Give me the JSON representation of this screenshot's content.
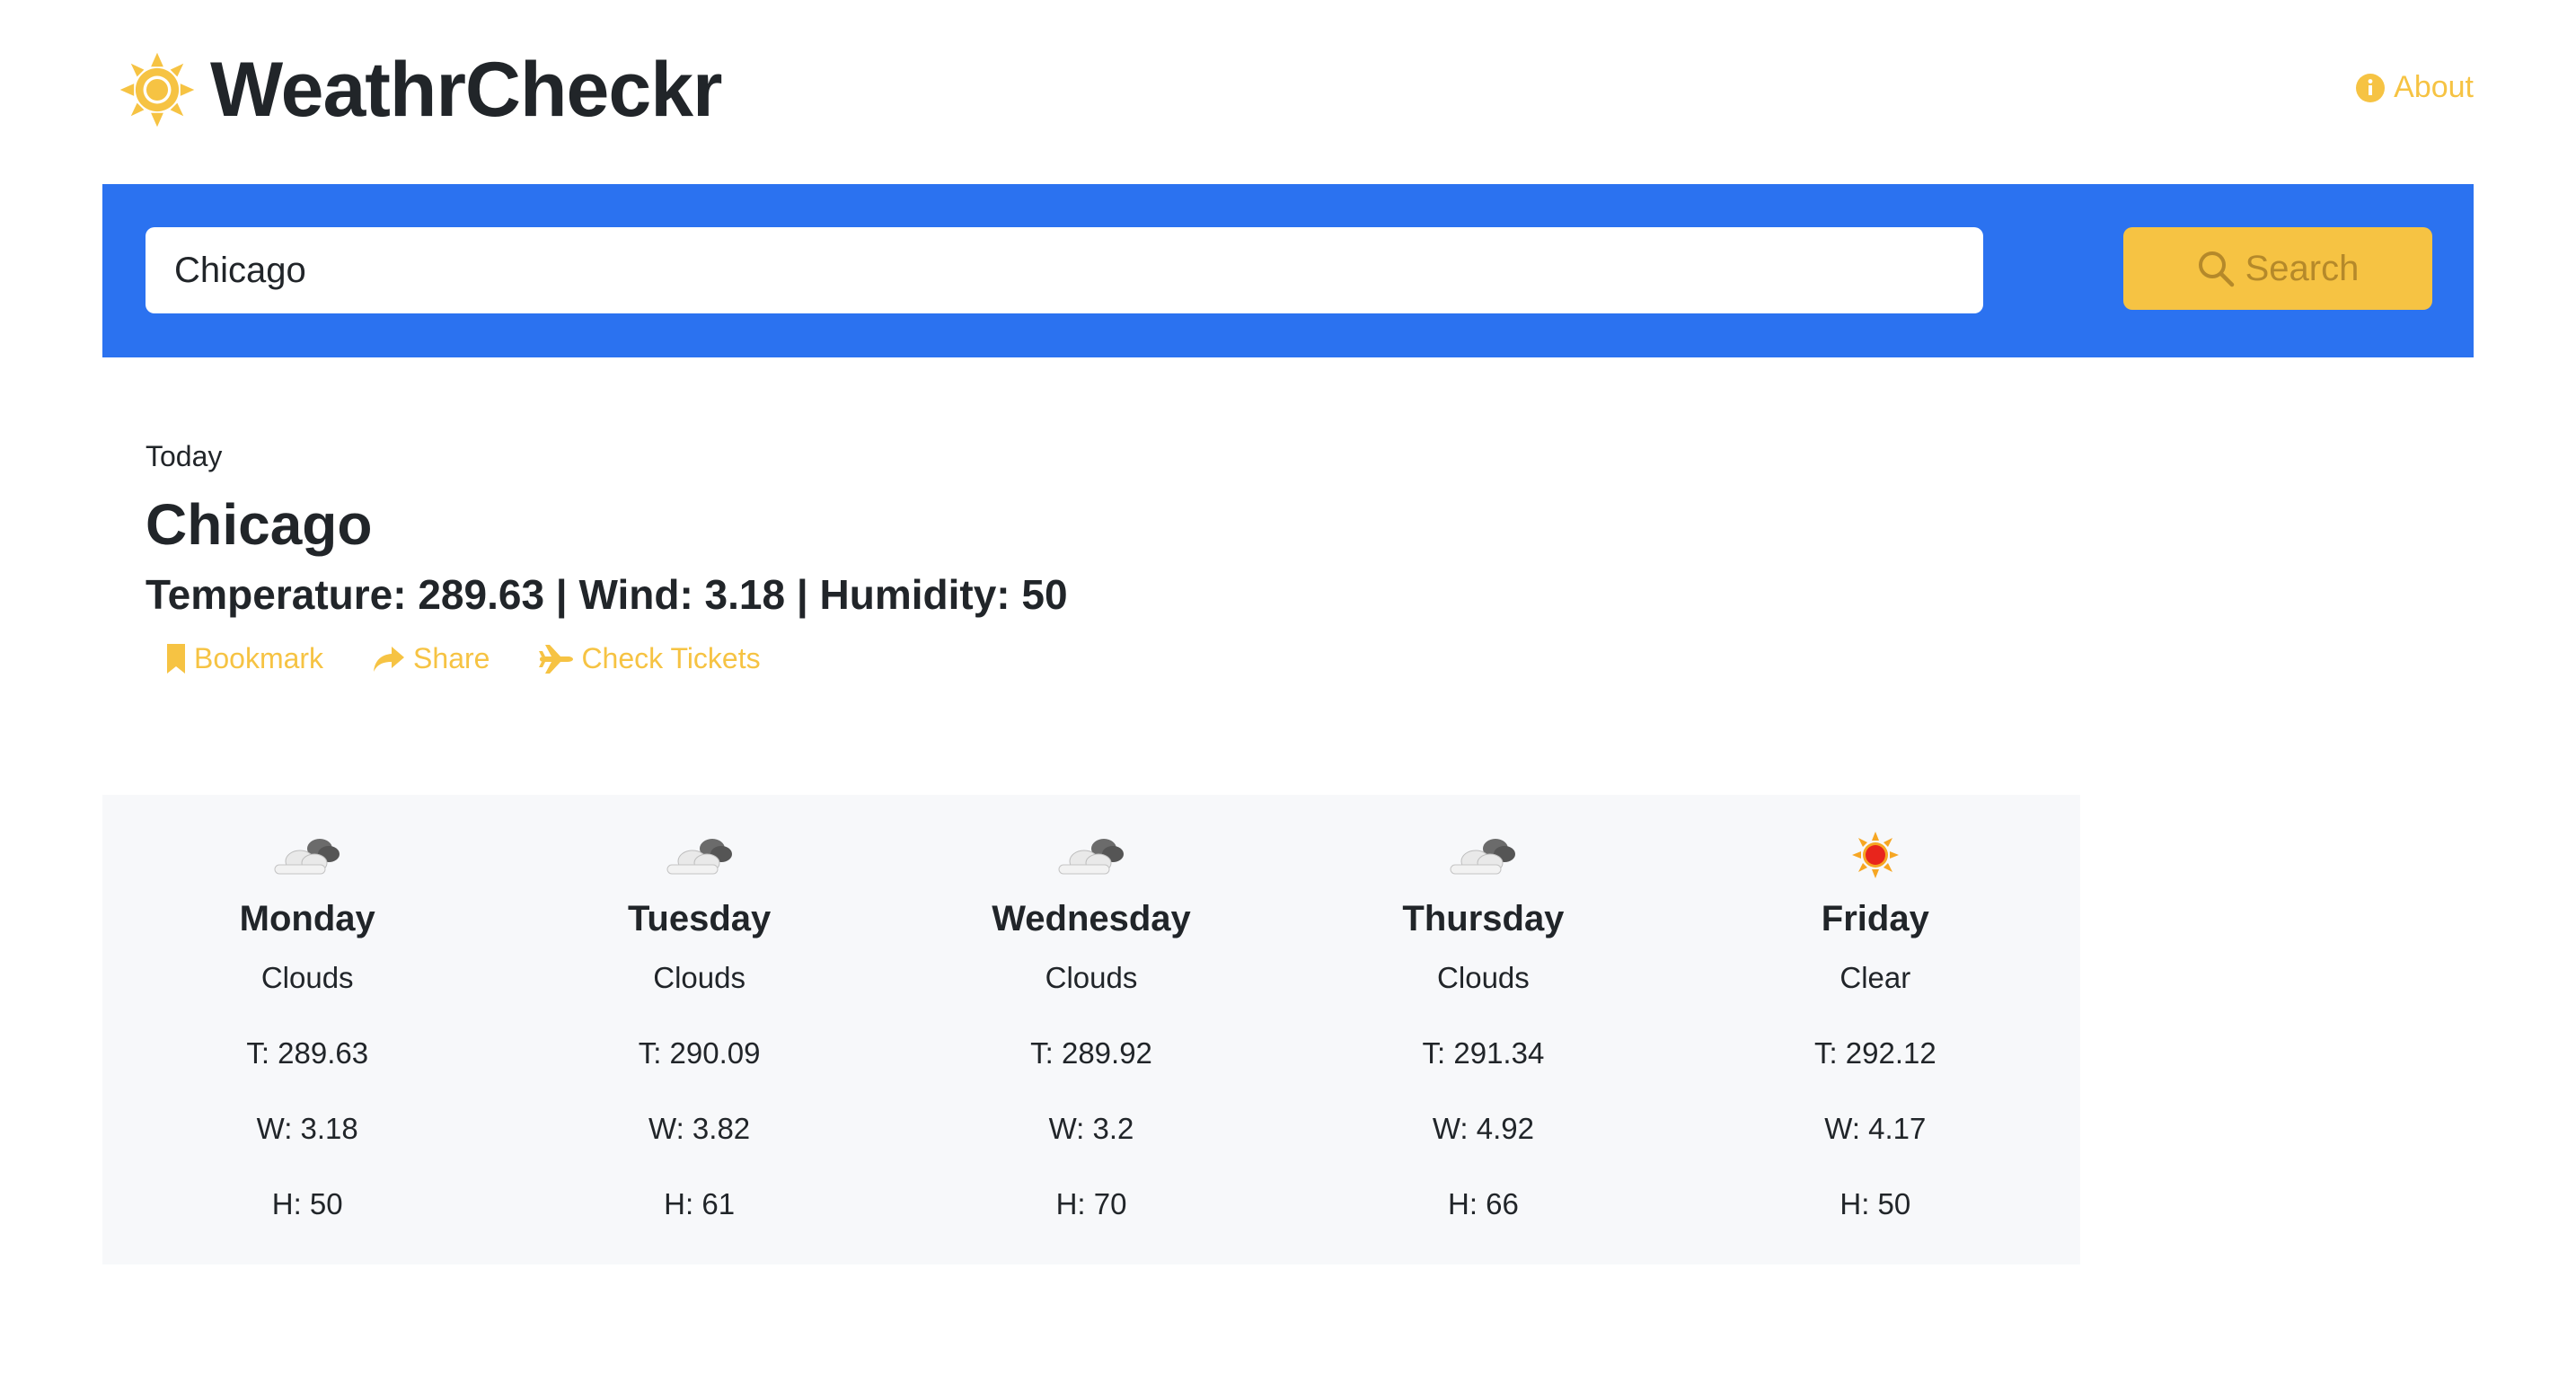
{
  "header": {
    "brand": "WeathrCheckr",
    "about_label": "About"
  },
  "search": {
    "value": "Chicago",
    "button_label": "Search"
  },
  "today": {
    "label": "Today",
    "city": "Chicago",
    "stats": "Temperature: 289.63 | Wind: 3.18 | Humidity: 50",
    "actions": {
      "bookmark": "Bookmark",
      "share": "Share",
      "tickets": "Check Tickets"
    }
  },
  "forecast": [
    {
      "day": "Monday",
      "condition": "Clouds",
      "temp": "T: 289.63",
      "wind": "W: 3.18",
      "humidity": "H: 50",
      "icon": "clouds-icon"
    },
    {
      "day": "Tuesday",
      "condition": "Clouds",
      "temp": "T: 290.09",
      "wind": "W: 3.82",
      "humidity": "H: 61",
      "icon": "clouds-icon"
    },
    {
      "day": "Wednesday",
      "condition": "Clouds",
      "temp": "T: 289.92",
      "wind": "W: 3.2",
      "humidity": "H: 70",
      "icon": "clouds-icon"
    },
    {
      "day": "Thursday",
      "condition": "Clouds",
      "temp": "T: 291.34",
      "wind": "W: 4.92",
      "humidity": "H: 66",
      "icon": "clouds-icon"
    },
    {
      "day": "Friday",
      "condition": "Clear",
      "temp": "T: 292.12",
      "wind": "W: 4.17",
      "humidity": "H: 50",
      "icon": "sun-icon"
    }
  ],
  "colors": {
    "accent_yellow": "#f6c343",
    "search_bar_blue": "#2b72f0",
    "forecast_bg": "#f7f8fa",
    "text": "#212529"
  }
}
